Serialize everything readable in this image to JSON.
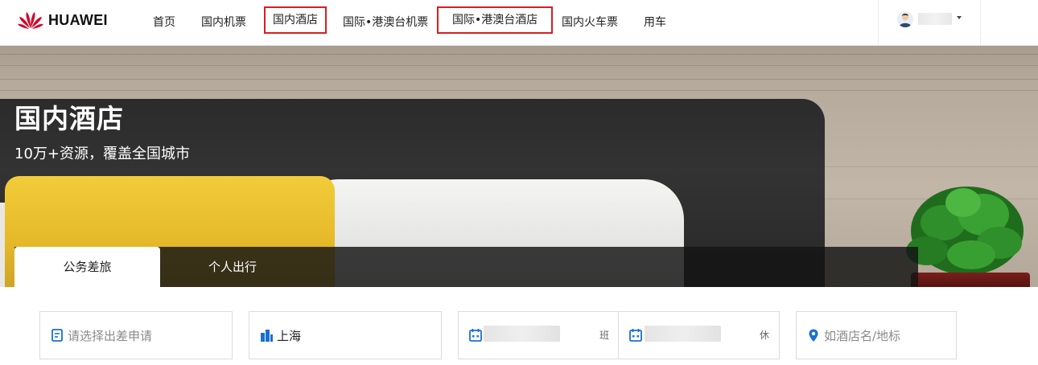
{
  "brand": {
    "name": "HUAWEI",
    "logo_icon": "huawei-flower-logo",
    "color": "#cf0a2c"
  },
  "nav": {
    "items": [
      {
        "label": "首页",
        "highlighted": false
      },
      {
        "label": "国内机票",
        "highlighted": false
      },
      {
        "label": "国内酒店",
        "highlighted": true
      },
      {
        "label": "国际•港澳台机票",
        "highlighted": false
      },
      {
        "label": "国际•港澳台酒店",
        "highlighted": true
      },
      {
        "label": "国内火车票",
        "highlighted": false
      },
      {
        "label": "用车",
        "highlighted": false
      }
    ],
    "highlight_color": "#d81e1e"
  },
  "user": {
    "avatar_icon": "user-avatar-icon",
    "menu_icon": "caret-down-icon"
  },
  "hero": {
    "title": "国内酒店",
    "subtitle": "10万+资源，覆盖全国城市"
  },
  "tabs": [
    {
      "label": "公务差旅",
      "active": true
    },
    {
      "label": "个人出行",
      "active": false
    }
  ],
  "search": {
    "trip_request": {
      "placeholder": "请选择出差申请",
      "icon": "document-icon"
    },
    "city": {
      "value": "上海",
      "icon": "city-buildings-icon"
    },
    "checkin": {
      "tag": "班",
      "icon": "calendar-icon"
    },
    "checkout": {
      "tag": "休",
      "icon": "calendar-icon"
    },
    "keyword": {
      "placeholder": "如酒店名/地标",
      "icon": "location-pin-icon"
    }
  },
  "colors": {
    "accent_blue": "#1a6fd1",
    "tab_bar_bg": "#141414"
  }
}
